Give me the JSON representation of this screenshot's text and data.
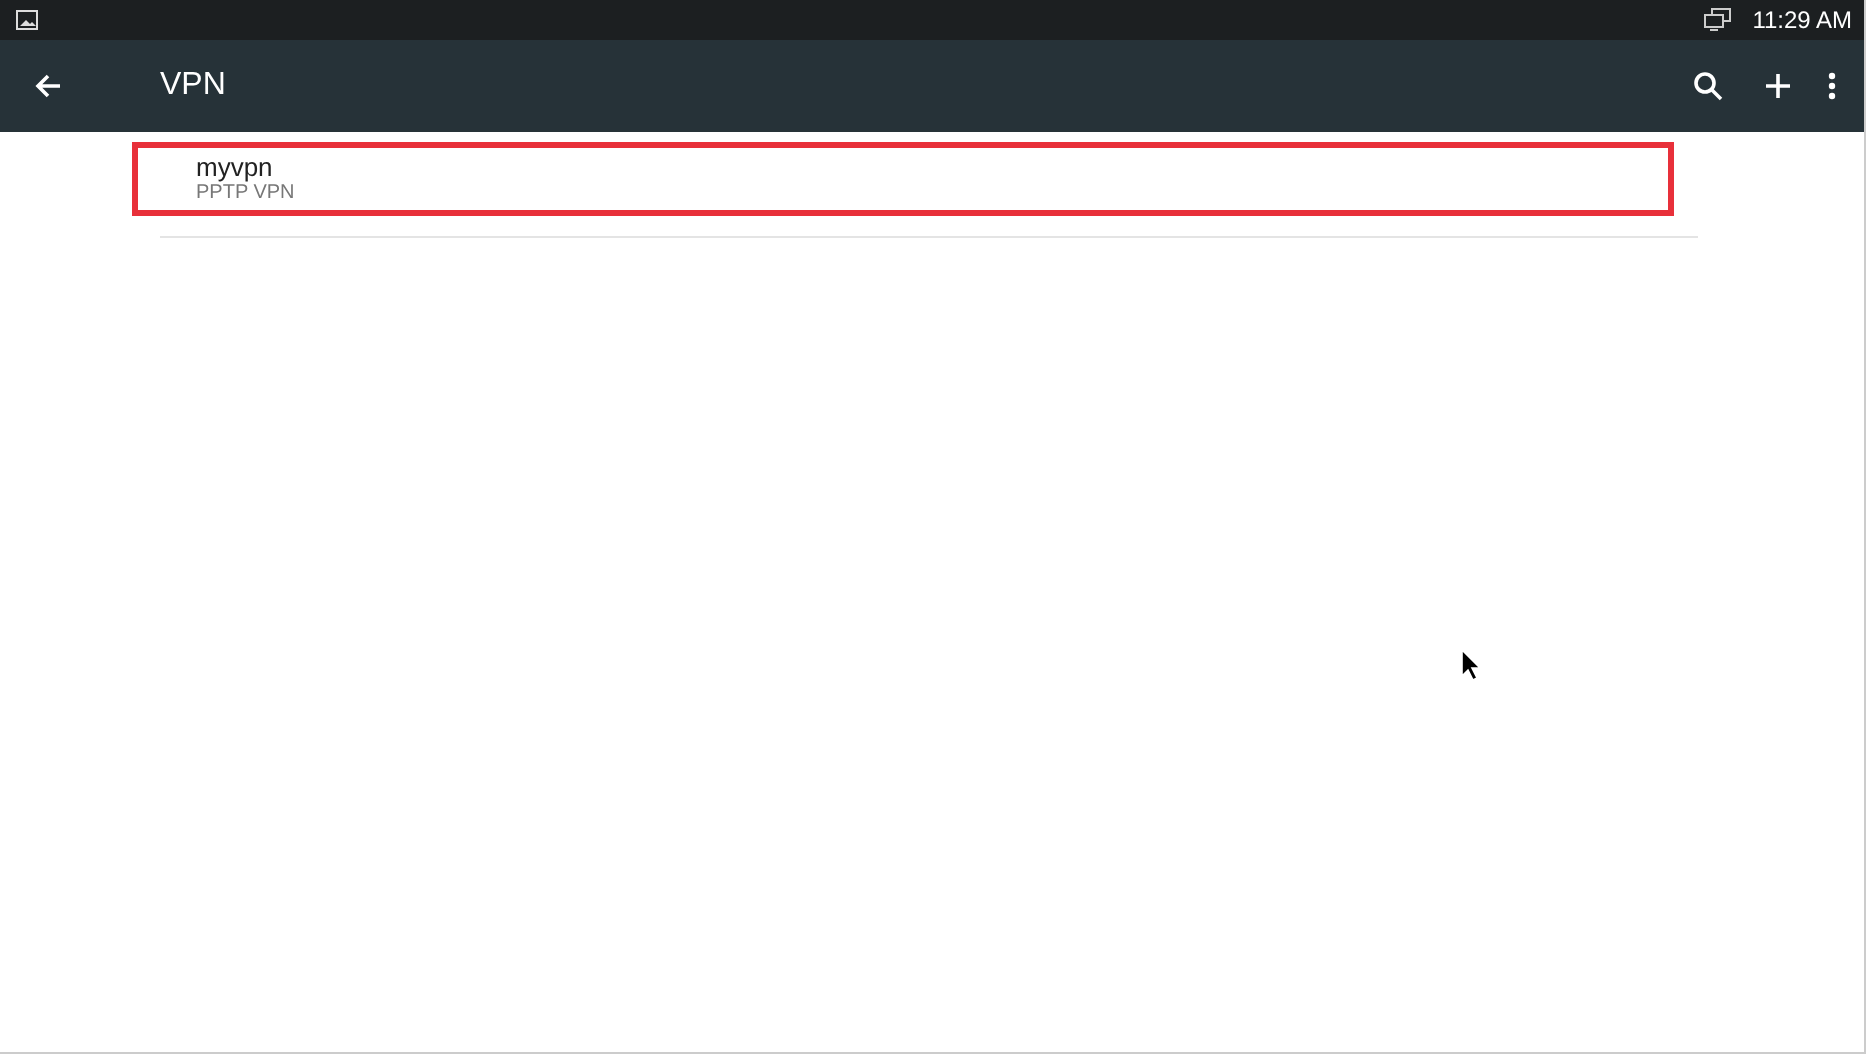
{
  "status_bar": {
    "time": "11:29 AM"
  },
  "toolbar": {
    "title": "VPN"
  },
  "vpn_list": [
    {
      "name": "myvpn",
      "type": "PPTP VPN",
      "highlighted": true
    }
  ]
}
